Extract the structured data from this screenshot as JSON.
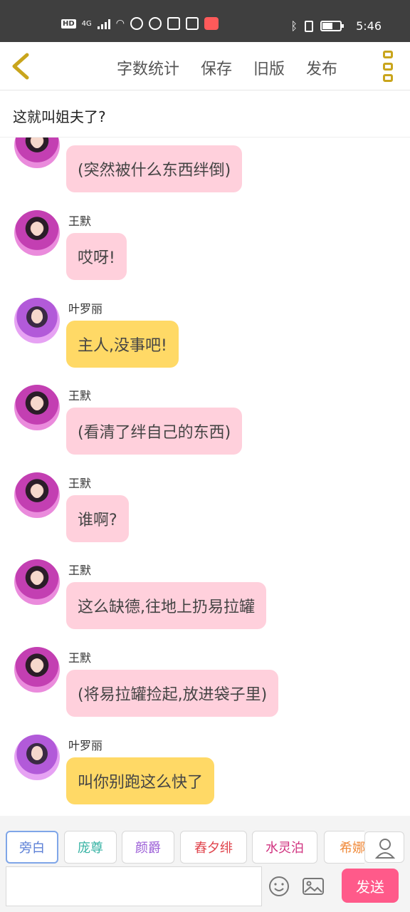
{
  "status_bar": {
    "hd": "HD",
    "network": "4G",
    "time": "5:46",
    "battery_level": 0.6
  },
  "toolbar": {
    "items": [
      "字数统计",
      "保存",
      "旧版",
      "发布"
    ]
  },
  "title": "这就叫姐夫了?",
  "messages": [
    {
      "name": "",
      "text": "(突然被什么东西绊倒)",
      "style": "pink",
      "avatar": "a"
    },
    {
      "name": "王默",
      "text": "哎呀!",
      "style": "pink",
      "avatar": "a"
    },
    {
      "name": "叶罗丽",
      "text": "主人,没事吧!",
      "style": "yellow",
      "avatar": "b"
    },
    {
      "name": "王默",
      "text": "(看清了绊自己的东西)",
      "style": "pink",
      "avatar": "a"
    },
    {
      "name": "王默",
      "text": "谁啊?",
      "style": "pink",
      "avatar": "a"
    },
    {
      "name": "王默",
      "text": "这么缺德,往地上扔易拉罐",
      "style": "pink",
      "avatar": "a"
    },
    {
      "name": "王默",
      "text": "(将易拉罐捡起,放进袋子里)",
      "style": "pink",
      "avatar": "a"
    },
    {
      "name": "叶罗丽",
      "text": "叫你别跑这么快了",
      "style": "yellow",
      "avatar": "b"
    }
  ],
  "characters": [
    {
      "label": "旁白",
      "color": "#5b7fd6",
      "active": true
    },
    {
      "label": "庞尊",
      "color": "#37b3a4",
      "active": false
    },
    {
      "label": "颜爵",
      "color": "#9a5bd6",
      "active": false
    },
    {
      "label": "舂夕绯",
      "color": "#e0444c",
      "active": false
    },
    {
      "label": "水灵泊",
      "color": "#d0307e",
      "active": false
    },
    {
      "label": "希娜",
      "color": "#f08a3a",
      "active": false
    }
  ],
  "input": {
    "value": "",
    "placeholder": ""
  },
  "send_label": "发送",
  "colors": {
    "pink": "#ffd0dc",
    "yellow": "#ffd966",
    "send": "#ff5a8a",
    "accent": "#c9a51c"
  }
}
